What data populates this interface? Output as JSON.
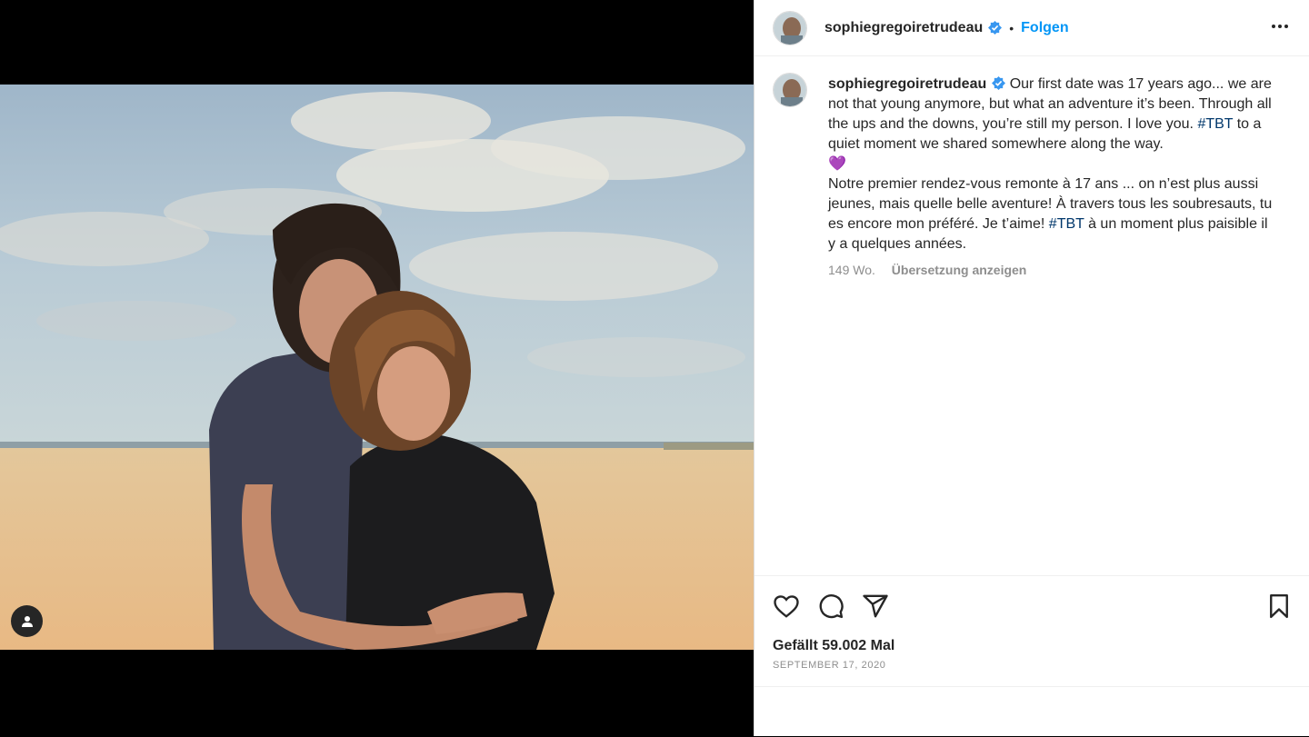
{
  "post": {
    "username": "sophiegregoiretrudeau",
    "follow_label": "Folgen",
    "separator": "•",
    "more_label": "•••"
  },
  "caption": {
    "username": "sophiegregoiretrudeau",
    "text_en_1": "Our first date was 17 years ago... we are not that young anymore, but what an adventure it’s been. Through all the ups and the downs, you’re still my person. I love you.",
    "hashtag_1": "#TBT",
    "text_en_2": "to a quiet moment we shared somewhere along the way.",
    "emoji": "💜",
    "text_fr_1": "Notre premier rendez-vous remonte à 17 ans ... on n’est plus aussi jeunes, mais quelle belle aventure! À travers tous les soubresauts, tu es encore mon préféré. Je t’aime!",
    "hashtag_2": "#TBT",
    "text_fr_2": "à un moment plus paisible il y a quelques années.",
    "age": "149 Wo.",
    "translate_label": "Übersetzung anzeigen"
  },
  "footer": {
    "likes": "Gefällt 59.002 Mal",
    "date": "SEPTEMBER 17, 2020"
  },
  "colors": {
    "accent": "#0095f6",
    "verified": "#3897f0",
    "hashtag": "#00376b"
  },
  "icons": {
    "tag": "user-tag-icon",
    "like": "heart-icon",
    "comment": "comment-icon",
    "share": "paper-plane-icon",
    "save": "bookmark-icon",
    "more": "more-horizontal-icon",
    "verified": "verified-badge-icon"
  }
}
